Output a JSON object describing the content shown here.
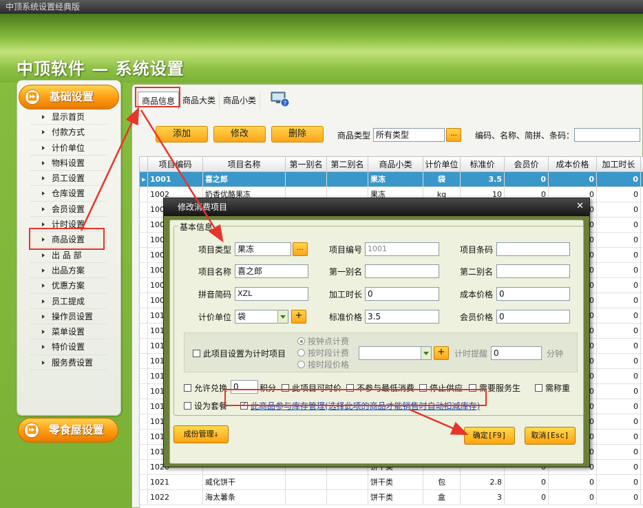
{
  "window": {
    "title": "中顶系统设置经典版"
  },
  "banner": {
    "title": "中顶软件 — 系统设置"
  },
  "sidebar": {
    "section1": "基础设置",
    "items": [
      "显示首页",
      "付款方式",
      "计价单位",
      "物料设置",
      "员工设置",
      "仓库设置",
      "会员设置",
      "计时设置",
      "商品设置",
      "出 品 部",
      "出品方案",
      "优惠方案",
      "员工提成",
      "操作员设置",
      "菜单设置",
      "特价设置",
      "服务费设置"
    ],
    "section2": "零食屋设置"
  },
  "tabs": [
    "商品信息",
    "商品大类",
    "商品小类"
  ],
  "toolbar": {
    "add": "添加",
    "edit": "修改",
    "delete": "删除",
    "type_label": "商品类型",
    "type_value": "所有类型",
    "dots": "...",
    "search_label": "编码、名称、简拼、条码：",
    "search_value": ""
  },
  "grid": {
    "headers": [
      "项目编码",
      "项目名称",
      "第一别名",
      "第二别名",
      "商品小类",
      "计价单位",
      "标准价",
      "会员价",
      "成本价格",
      "加工时长"
    ],
    "rows": [
      [
        "1001",
        "喜之郎",
        "",
        "",
        "果冻",
        "袋",
        "3.5",
        "0",
        "0",
        "0"
      ],
      [
        "1002",
        "奶香优酪果冻",
        "",
        "",
        "果冻",
        "kg",
        "10",
        "0",
        "0",
        "0"
      ],
      [
        "1003",
        "",
        "",
        "",
        "",
        "",
        "",
        "0",
        "0",
        "0"
      ],
      [
        "1004",
        "",
        "",
        "",
        "",
        "",
        "",
        "0",
        "0",
        "0"
      ],
      [
        "1005",
        "",
        "",
        "",
        "",
        "",
        "",
        "0",
        "0",
        "0"
      ],
      [
        "1006",
        "",
        "",
        "",
        "",
        "",
        "",
        "0",
        "0",
        "0"
      ],
      [
        "1007",
        "",
        "",
        "",
        "",
        "",
        "",
        "0",
        "0",
        "0"
      ],
      [
        "1008",
        "",
        "",
        "",
        "",
        "",
        "",
        "0",
        "0",
        "0"
      ],
      [
        "1009",
        "",
        "",
        "",
        "",
        "",
        "",
        "0",
        "0",
        "0"
      ],
      [
        "1010",
        "",
        "",
        "",
        "",
        "",
        "",
        "0",
        "0",
        "0"
      ],
      [
        "1011",
        "",
        "",
        "",
        "",
        "",
        "",
        "0",
        "0",
        "0"
      ],
      [
        "1012",
        "",
        "",
        "",
        "",
        "",
        "",
        "0",
        "0",
        "0"
      ],
      [
        "1013",
        "",
        "",
        "",
        "",
        "",
        "",
        "0",
        "0",
        "0"
      ],
      [
        "1014",
        "",
        "",
        "",
        "",
        "",
        "",
        "0",
        "0",
        "0"
      ],
      [
        "1015",
        "",
        "",
        "",
        "",
        "",
        "",
        "0",
        "0",
        "0"
      ],
      [
        "1016",
        "",
        "",
        "",
        "",
        "",
        "",
        "0",
        "0",
        "0"
      ],
      [
        "1017",
        "",
        "",
        "",
        "",
        "",
        "",
        "0",
        "0",
        "0"
      ],
      [
        "1018",
        "",
        "",
        "",
        "",
        "",
        "",
        "0",
        "0",
        "0"
      ],
      [
        "1019",
        "",
        "",
        "",
        "",
        "",
        "",
        "0",
        "0",
        "0"
      ],
      [
        "1020",
        "",
        "",
        "",
        "饼干类",
        "",
        "",
        "0",
        "0",
        "0"
      ],
      [
        "1021",
        "威化饼干",
        "",
        "",
        "饼干类",
        "包",
        "2.8",
        "0",
        "0",
        "0"
      ],
      [
        "1022",
        "海太薯条",
        "",
        "",
        "饼干类",
        "盒",
        "3",
        "0",
        "0",
        "0"
      ]
    ]
  },
  "dialog": {
    "title": "修改消费项目",
    "group_label": "基本信息",
    "project_type_label": "项目类型",
    "project_type_value": "果冻",
    "project_code_label": "项目编号",
    "project_code_value": "1001",
    "barcode_label": "项目条码",
    "barcode_value": "",
    "name_label": "项目名称",
    "name_value": "喜之郎",
    "alias1_label": "第一别名",
    "alias1_value": "",
    "alias2_label": "第二别名",
    "alias2_value": "",
    "pinyin_label": "拼音简码",
    "pinyin_value": "XZL",
    "proc_time_label": "加工时长",
    "proc_time_value": "0",
    "cost_label": "成本价格",
    "cost_value": "0",
    "unit_label": "计价单位",
    "unit_value": "袋",
    "plus": "+",
    "std_price_label": "标准价格",
    "std_price_value": "3.5",
    "member_price_label": "会员价格",
    "member_price_value": "0",
    "timing_check": "此项目设置为计时项目",
    "radio1": "按钟点计费",
    "radio2": "按时段计费",
    "radio3": "按时段价格",
    "timing_remind_label": "计时提醒",
    "timing_remind_value": "0",
    "minute_label": "分钟",
    "allow_exchange": "允许兑换",
    "exchange_value": "0",
    "points_label": "积分",
    "timed_price": "此项目可时价",
    "no_min_spend": "不参与最低消费",
    "stop_supply": "停止供应",
    "need_waiter": "需要服务生",
    "need_weigh": "需称重",
    "set_meal": "设为套餐",
    "inventory_check": "此商品参与库存管理(选择此项的商品才能销售时自动扣减库存)",
    "component_btn": "成份管理↓",
    "ok_btn": "确定[F9]",
    "cancel_btn": "取消[Esc]"
  }
}
